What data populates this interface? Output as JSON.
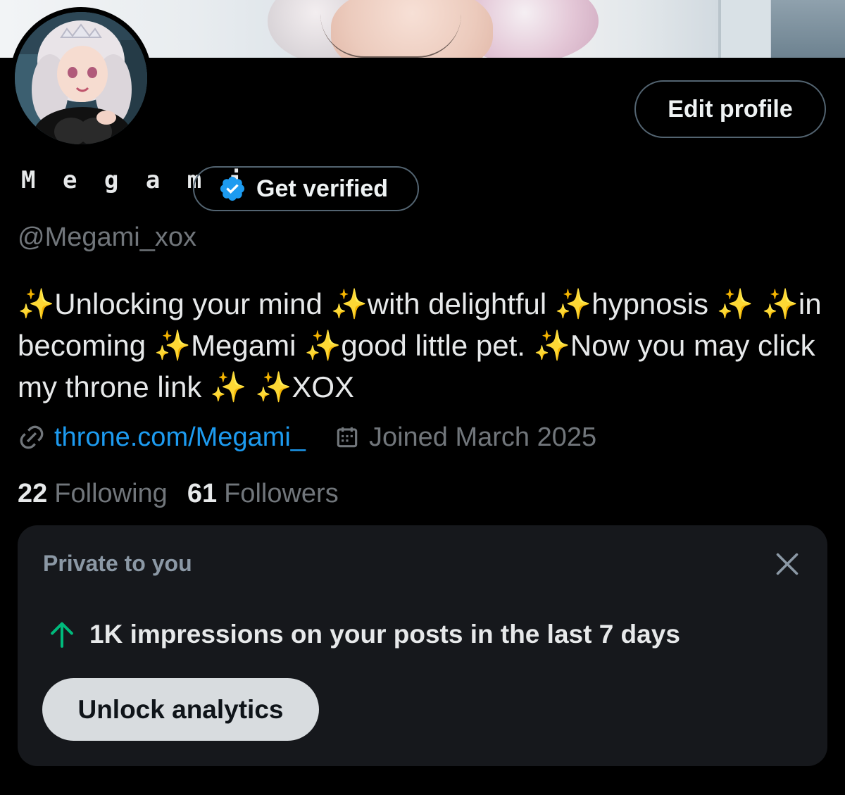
{
  "profile": {
    "display_name": "M e g a m i",
    "handle": "@Megami_xox",
    "bio": "✨Unlocking your mind ✨with delightful ✨hypnosis ✨ ✨in becoming ✨Megami ✨good little pet. ✨Now you may click my throne link ✨ ✨XOX",
    "link": "throne.com/Megami_",
    "joined": "Joined March 2025",
    "following_count": "22",
    "following_label": "Following",
    "followers_count": "61",
    "followers_label": "Followers"
  },
  "buttons": {
    "edit_profile": "Edit profile",
    "get_verified": "Get verified"
  },
  "private_card": {
    "title": "Private to you",
    "impressions_text": "1K impressions on your posts in the last 7 days",
    "unlock_button": "Unlock analytics"
  },
  "icons": {
    "verified_badge": "verified-badge-icon",
    "link": "link-icon",
    "calendar": "calendar-icon",
    "close": "close-icon",
    "arrow_up": "arrow-up-icon"
  },
  "colors": {
    "background": "#000000",
    "accent_blue": "#1d9bf0",
    "secondary_text": "#71767b",
    "primary_text": "#e7e9ea",
    "card_background": "#16181c",
    "trend_up_green": "#00ba7c",
    "button_border": "#536471"
  }
}
